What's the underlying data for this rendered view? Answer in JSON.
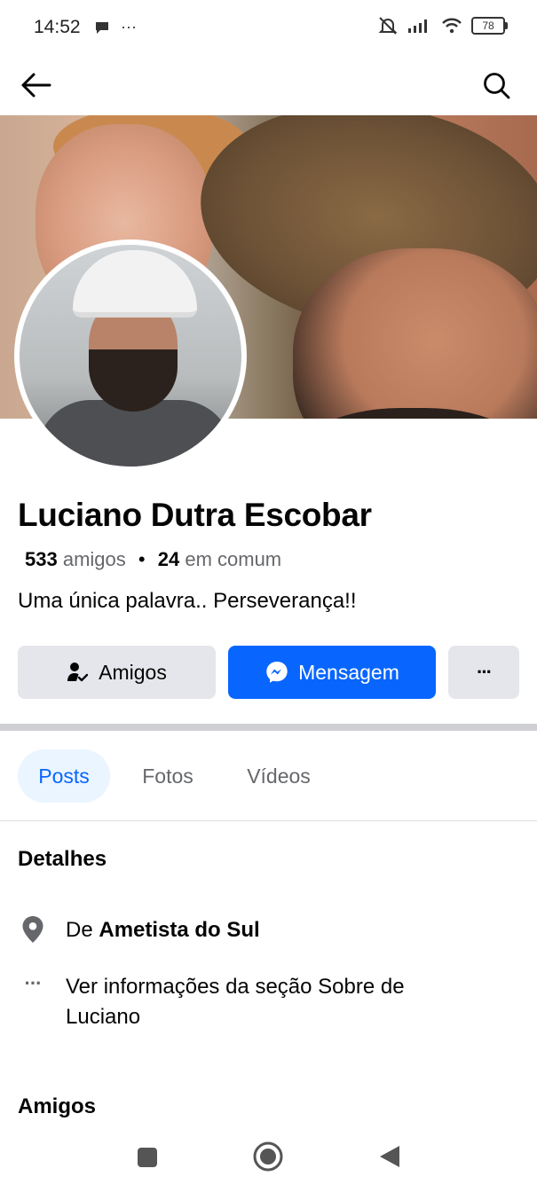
{
  "status_bar": {
    "time": "14:52",
    "left_icons": [
      "chat-icon",
      "more-notifications"
    ],
    "more_dots": "···",
    "battery": "78",
    "right_icons": [
      "mute-icon",
      "signal-icon",
      "wifi-icon",
      "battery-icon"
    ]
  },
  "nav": {
    "back_icon": "arrow-left-icon",
    "search_icon": "search-icon"
  },
  "profile": {
    "name": "Luciano Dutra Escobar",
    "friends_count": "533",
    "friends_label": "amigos",
    "separator": "•",
    "mutual_count": "24",
    "mutual_label": "em comum",
    "bio": "Uma única palavra.. Perseverança!!"
  },
  "actions": {
    "friends_label": "Amigos",
    "message_label": "Mensagem",
    "more_label": "···"
  },
  "tabs": [
    {
      "label": "Posts",
      "active": true
    },
    {
      "label": "Fotos",
      "active": false
    },
    {
      "label": "Vídeos",
      "active": false
    }
  ],
  "details": {
    "title": "Detalhes",
    "hometown_prefix": "De ",
    "hometown": "Ametista do Sul",
    "about_line1": "Ver informações da seção Sobre de",
    "about_line2": "Luciano",
    "about_icon_text": "···"
  },
  "friends_section": {
    "title": "Amigos"
  },
  "colors": {
    "accent": "#0866ff",
    "button_gray": "#e4e6eb",
    "secondary_text": "#65676b",
    "active_tab_bg": "#ebf5ff"
  }
}
